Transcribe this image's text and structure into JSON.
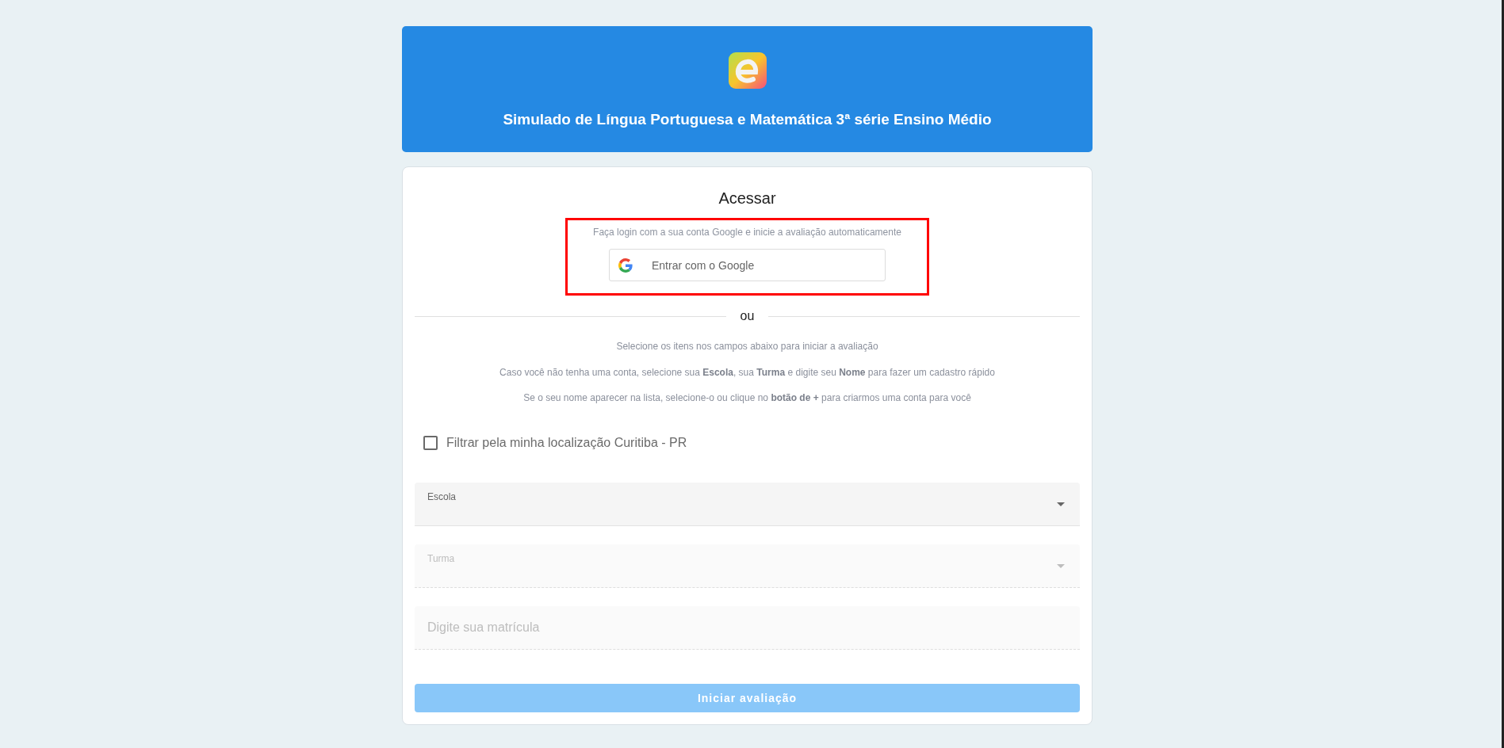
{
  "header": {
    "title": "Simulado de Língua Portuguesa e Matemática 3ª série Ensino Médio"
  },
  "login": {
    "heading": "Acessar",
    "google": {
      "highlighted": true,
      "hint": "Faça login com a sua conta Google e inicie a avaliação automaticamente",
      "button": "Entrar com o Google"
    },
    "divider": "ou",
    "instructions": [
      "Selecione os itens nos campos abaixo para iniciar a avaliação",
      "Caso você não tenha uma conta, selecione sua **Escola**, sua **Turma** e digite seu **Nome** para fazer um cadastro rápido",
      "Se o seu nome aparecer na lista, selecione-o ou clique no **botão de +** para criarmos uma conta para você"
    ],
    "location_filter": {
      "label": "Filtrar pela minha localização Curitiba - PR",
      "checked": false
    },
    "fields": [
      {
        "kind": "select",
        "label": "Escola",
        "disabled": false
      },
      {
        "kind": "select",
        "label": "Turma",
        "disabled": true
      },
      {
        "kind": "text",
        "placeholder": "Digite sua matrícula",
        "disabled": true
      }
    ],
    "submit_button": {
      "label": "Iniciar avaliação",
      "disabled": true
    }
  }
}
